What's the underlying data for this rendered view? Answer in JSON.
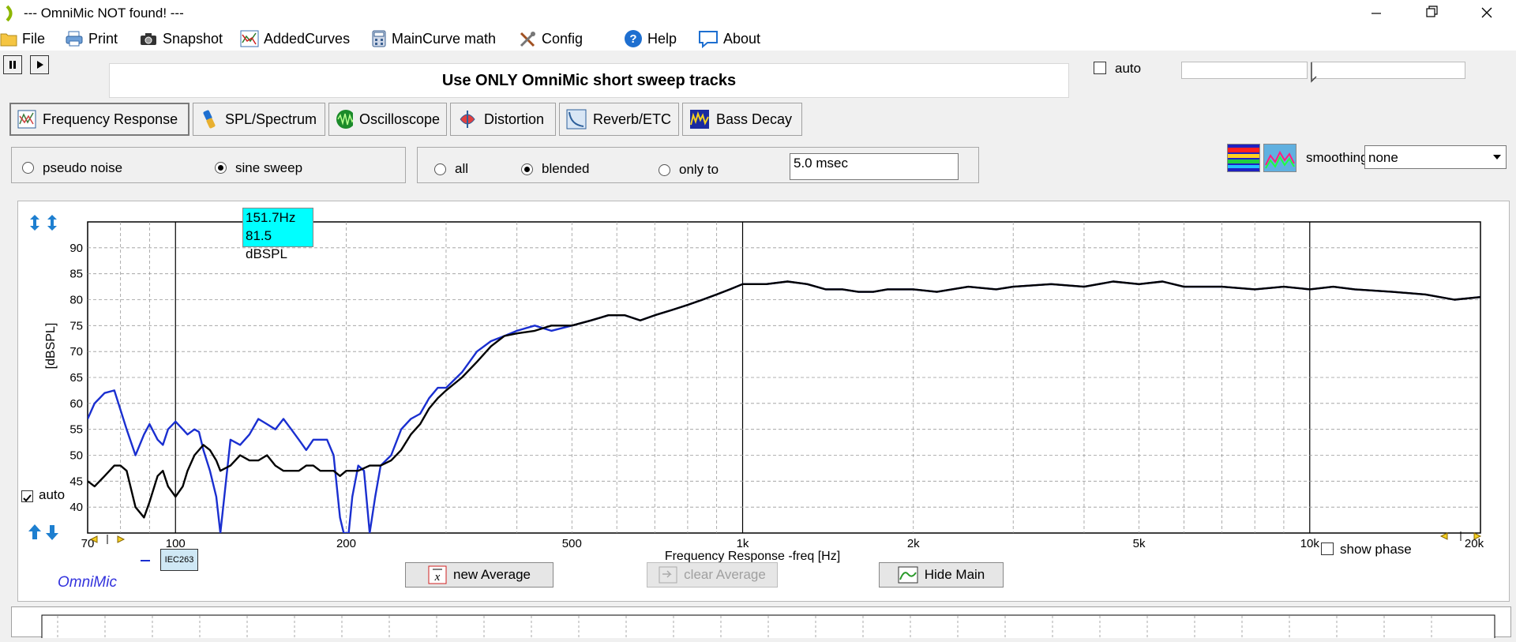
{
  "window": {
    "title": "--- OmniMic NOT found! ---"
  },
  "menu": [
    {
      "label": "File",
      "icon": "folder-icon"
    },
    {
      "label": "Print",
      "icon": "printer-icon"
    },
    {
      "label": "Snapshot",
      "icon": "camera-icon"
    },
    {
      "label": "AddedCurves",
      "icon": "curves-icon"
    },
    {
      "label": "MainCurve math",
      "icon": "calculator-icon"
    },
    {
      "label": "Config",
      "icon": "tools-icon"
    },
    {
      "label": "Help",
      "icon": "help-icon"
    },
    {
      "label": "About",
      "icon": "speech-bubble-icon"
    }
  ],
  "banner": {
    "text": "Use ONLY OmniMic short sweep tracks"
  },
  "top_auto": {
    "label": "auto",
    "checked": false
  },
  "tabs": [
    {
      "label": "Frequency Response",
      "active": true
    },
    {
      "label": "SPL/Spectrum"
    },
    {
      "label": "Oscilloscope"
    },
    {
      "label": "Distortion"
    },
    {
      "label": "Reverb/ETC"
    },
    {
      "label": "Bass Decay"
    }
  ],
  "signal": {
    "options": [
      "pseudo noise",
      "sine sweep"
    ],
    "selected": "sine sweep"
  },
  "gating": {
    "options": [
      "all",
      "blended",
      "only to"
    ],
    "selected": "blended",
    "time_value": "5.0 msec"
  },
  "smoothing": {
    "label": "smoothing",
    "value": "none"
  },
  "cursor": {
    "freq": "151.7Hz",
    "level": "81.5 dBSPL"
  },
  "chart_auto": {
    "label": "auto",
    "checked": true
  },
  "legend_tag": "IEC263",
  "brand": "OmniMic",
  "show_phase": {
    "label": "show phase",
    "checked": false
  },
  "buttons": {
    "new_average": "new Average",
    "clear_average": "clear Average",
    "hide_main": "Hide Main"
  },
  "colors": {
    "main_curve": "#000000",
    "blue_curve": "#1a2fd0",
    "cursor_box": "#00ffff",
    "brand": "#3333dd"
  },
  "chart_data": {
    "type": "line",
    "xlabel": "Frequency Response -freq [Hz]",
    "ylabel": "[dBSPL]",
    "x_scale": "log",
    "xlim": [
      70,
      20000
    ],
    "ylim": [
      35,
      95
    ],
    "x_ticks": [
      {
        "value": 70,
        "label": "70"
      },
      {
        "value": 100,
        "label": "100"
      },
      {
        "value": 200,
        "label": "200"
      },
      {
        "value": 500,
        "label": "500"
      },
      {
        "value": 1000,
        "label": "1k"
      },
      {
        "value": 2000,
        "label": "2k"
      },
      {
        "value": 5000,
        "label": "5k"
      },
      {
        "value": 10000,
        "label": "10k"
      },
      {
        "value": 20000,
        "label": "20k"
      }
    ],
    "y_ticks": [
      40,
      45,
      50,
      55,
      60,
      65,
      70,
      75,
      80,
      85,
      90
    ],
    "grid": true,
    "series": [
      {
        "color": "#1a2fd0",
        "x": [
          70,
          72,
          75,
          78,
          82,
          85,
          88,
          90,
          93,
          95,
          97,
          100,
          103,
          105,
          108,
          110,
          112,
          115,
          118,
          120,
          125,
          130,
          135,
          140,
          145,
          150,
          155,
          160,
          165,
          170,
          175,
          180,
          185,
          190,
          195,
          198,
          200,
          202,
          205,
          210,
          215,
          220,
          225,
          230,
          240,
          250,
          260,
          270,
          280,
          290,
          300,
          320,
          340,
          360,
          380,
          400,
          430,
          460,
          500,
          540,
          580,
          620,
          660,
          700,
          750,
          800,
          850,
          900,
          950,
          1000,
          1050,
          1100,
          1200,
          1300,
          1400,
          1500,
          1600,
          1700,
          1800,
          2000,
          2200,
          2500,
          2800,
          3000,
          3500,
          4000,
          4500,
          5000,
          5500,
          6000,
          6500,
          7000,
          8000,
          9000,
          10000,
          11000,
          12000,
          14000,
          16000,
          18000,
          20000
        ],
        "y": [
          57,
          60,
          62,
          62.5,
          55,
          50,
          54,
          56,
          53,
          52,
          55,
          56.5,
          55,
          54,
          55,
          54.5,
          51,
          47,
          42,
          30,
          53,
          52,
          54,
          57,
          56,
          55,
          57,
          55,
          53,
          51,
          53,
          53,
          53,
          50,
          38,
          28,
          25,
          28,
          42,
          48,
          47,
          33,
          42,
          48,
          50,
          55,
          57,
          58,
          61,
          63,
          63,
          66,
          70,
          72,
          73,
          74,
          75,
          74,
          75,
          76,
          77,
          77,
          76,
          77,
          78,
          79,
          80,
          81,
          82,
          83,
          83,
          83,
          83.5,
          83,
          82,
          82,
          81.5,
          81.5,
          82,
          82,
          81.5,
          82.5,
          82,
          82.5,
          83,
          82.5,
          83.5,
          83,
          83.5,
          82.5,
          82.5,
          82.5,
          82,
          82.5,
          82,
          82.5,
          82,
          81.5,
          81,
          80,
          80.5
        ]
      },
      {
        "color": "#000000",
        "x": [
          70,
          72,
          75,
          78,
          80,
          82,
          85,
          88,
          90,
          93,
          95,
          97,
          100,
          103,
          105,
          108,
          110,
          112,
          115,
          118,
          120,
          125,
          130,
          135,
          140,
          145,
          150,
          155,
          160,
          165,
          170,
          175,
          180,
          185,
          190,
          195,
          200,
          210,
          220,
          230,
          240,
          250,
          260,
          270,
          280,
          290,
          300,
          320,
          340,
          360,
          380,
          400,
          430,
          460,
          500,
          540,
          580,
          620,
          660,
          700,
          750,
          800,
          850,
          900,
          950,
          1000,
          1050,
          1100,
          1200,
          1300,
          1400,
          1500,
          1600,
          1700,
          1800,
          2000,
          2200,
          2500,
          2800,
          3000,
          3500,
          4000,
          4500,
          5000,
          5500,
          6000,
          6500,
          7000,
          8000,
          9000,
          10000,
          11000,
          12000,
          14000,
          16000,
          18000,
          20000
        ],
        "y": [
          45,
          44,
          46,
          48,
          48,
          47,
          40,
          38,
          41,
          46,
          47,
          44,
          42,
          44,
          47,
          50,
          51,
          52,
          51,
          49,
          47,
          48,
          50,
          49,
          49,
          50,
          48,
          47,
          47,
          47,
          48,
          48,
          47,
          47,
          47,
          46,
          47,
          47,
          48,
          48,
          49,
          51,
          54,
          56,
          59,
          61,
          62.5,
          65,
          68,
          71,
          73,
          73.5,
          74,
          75,
          75,
          76,
          77,
          77,
          76,
          77,
          78,
          79,
          80,
          81,
          82,
          83,
          83,
          83,
          83.5,
          83,
          82,
          82,
          81.5,
          81.5,
          82,
          82,
          81.5,
          82.5,
          82,
          82.5,
          83,
          82.5,
          83.5,
          83,
          83.5,
          82.5,
          82.5,
          82.5,
          82,
          82.5,
          82,
          82.5,
          82,
          81.5,
          81,
          80,
          80.5
        ]
      }
    ]
  }
}
